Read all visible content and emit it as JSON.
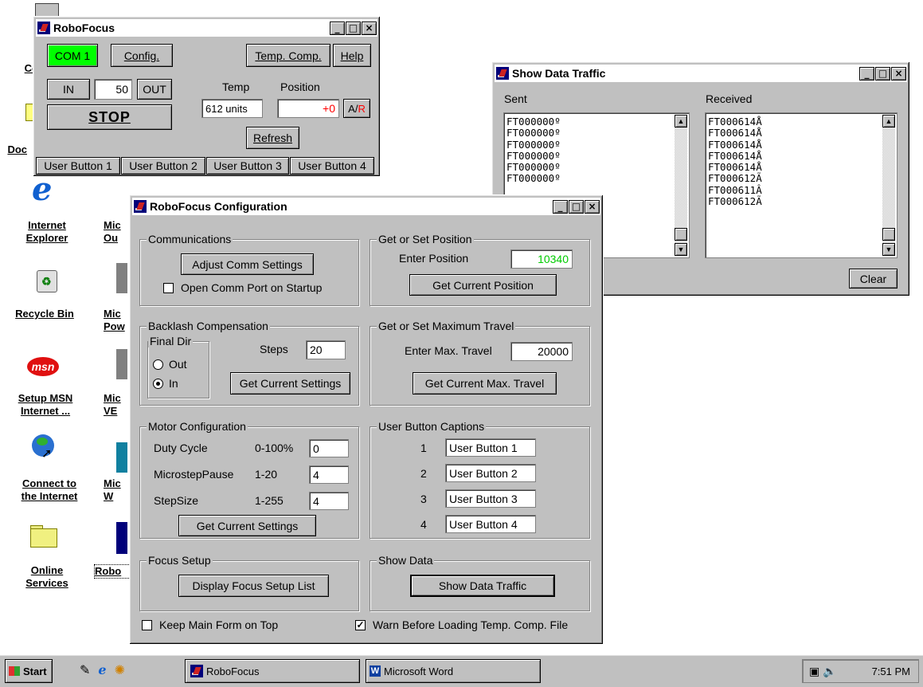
{
  "desktop": {
    "icons": [
      {
        "label_line1": "Co",
        "label_line2": "",
        "icon": "computer-icon"
      },
      {
        "label_line1": "Doc",
        "label_line2": "",
        "icon": "folder-icon"
      },
      {
        "label_line1": "Internet",
        "label_line2": "Explorer",
        "icon": "internet-explorer-icon"
      },
      {
        "label_line1": "Recycle Bin",
        "label_line2": "",
        "icon": "recycle-bin-icon"
      },
      {
        "label_line1": "Setup MSN",
        "label_line2": "Internet ...",
        "icon": "msn-icon"
      },
      {
        "label_line1": "Connect to",
        "label_line2": "the Internet",
        "icon": "connect-icon"
      },
      {
        "label_line1": "Online",
        "label_line2": "Services",
        "icon": "folder-icon"
      }
    ],
    "icons_col2": [
      {
        "label_line1": "Mic",
        "label_line2": "Ou"
      },
      {
        "label_line1": "Mic",
        "label_line2": "Pow"
      },
      {
        "label_line1": "Mic",
        "label_line2": "VE"
      },
      {
        "label_line1": "Mic",
        "label_line2": "W"
      },
      {
        "label_line1": "Robo",
        "label_line2": ""
      }
    ]
  },
  "robofocus": {
    "title": "RoboFocus",
    "com_label": "COM 1",
    "com_color": "#00ff00",
    "config_label": "Config.",
    "temp_comp_label": "Temp. Comp.",
    "help_label": "Help",
    "in_label": "IN",
    "step_value": "50",
    "out_label": "OUT",
    "stop_label": "STOP",
    "temp_header": "Temp",
    "position_header": "Position",
    "temp_value": "612 units",
    "position_value": "+0",
    "ar_label_a": "A/",
    "ar_label_r": "R",
    "refresh_label": "Refresh",
    "user_buttons": [
      "User Button 1",
      "User Button 2",
      "User Button 3",
      "User Button 4"
    ]
  },
  "traffic": {
    "title": "Show Data Traffic",
    "sent_label": "Sent",
    "received_label": "Received",
    "sent_lines": [
      "FT000000º",
      "FT000000º",
      "FT000000º",
      "FT000000º",
      "FT000000º",
      "FT000000º"
    ],
    "received_lines": [
      "FT000614Å",
      "FT000614Å",
      "FT000614Å",
      "FT000614Å",
      "FT000614Å",
      "FT000612Ã",
      "FT000611Â",
      "FT000612Ã"
    ],
    "clear_label": "Clear"
  },
  "config": {
    "title": "RoboFocus Configuration",
    "comm": {
      "title": "Communications",
      "adjust_label": "Adjust Comm Settings",
      "open_on_startup_label": "Open Comm Port on Startup",
      "open_on_startup_checked": false
    },
    "position": {
      "title": "Get or Set Position",
      "enter_label": "Enter Position",
      "value": "10340",
      "value_color": "#00cc00",
      "get_label": "Get Current Position"
    },
    "backlash": {
      "title": "Backlash Compensation",
      "final_dir_label": "Final Dir",
      "out_label": "Out",
      "in_label": "In",
      "selected": "In",
      "steps_label": "Steps",
      "steps_value": "20",
      "get_label": "Get Current Settings"
    },
    "maxtravel": {
      "title": "Get or Set Maximum Travel",
      "enter_label": "Enter Max. Travel",
      "value": "20000",
      "get_label": "Get Current Max. Travel"
    },
    "motor": {
      "title": "Motor Configuration",
      "rows": [
        {
          "label": "Duty Cycle",
          "range": "0-100%",
          "value": "0"
        },
        {
          "label": "MicrostepPause",
          "range": "1-20",
          "value": "4"
        },
        {
          "label": "StepSize",
          "range": "1-255",
          "value": "4"
        }
      ],
      "get_label": "Get Current Settings"
    },
    "captions": {
      "title": "User Button Captions",
      "rows": [
        {
          "num": "1",
          "value": "User Button 1"
        },
        {
          "num": "2",
          "value": "User Button 2"
        },
        {
          "num": "3",
          "value": "User Button 3"
        },
        {
          "num": "4",
          "value": "User Button 4"
        }
      ]
    },
    "focus": {
      "title": "Focus Setup",
      "display_label": "Display Focus Setup List"
    },
    "showdata": {
      "title": "Show Data",
      "button_label": "Show Data Traffic"
    },
    "keep_on_top_label": "Keep Main Form on Top",
    "keep_on_top_checked": false,
    "warn_label": "Warn Before Loading Temp. Comp. File",
    "warn_checked": true
  },
  "taskbar": {
    "start_label": "Start",
    "tasks": [
      "RoboFocus",
      "Microsoft Word"
    ],
    "clock": "7:51 PM"
  }
}
